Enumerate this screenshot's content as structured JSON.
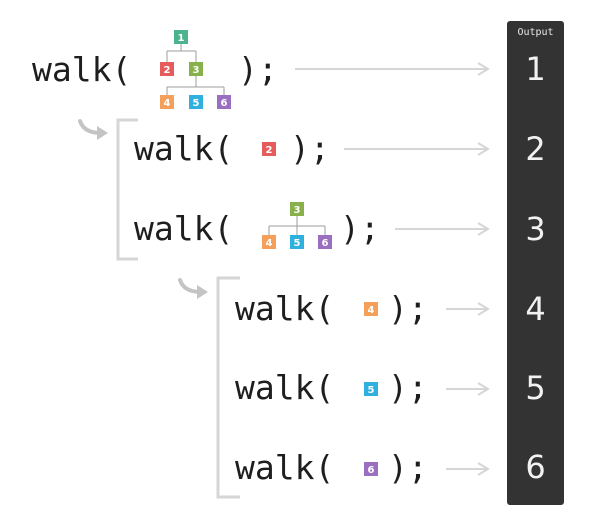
{
  "colors": {
    "node1": "#4db38e",
    "node2": "#e65c5c",
    "node3": "#88b04b",
    "node4": "#f5a05a",
    "node5": "#2fb0de",
    "node6": "#9b6fc0",
    "output_bg": "#333333"
  },
  "output": {
    "title": "Output",
    "values": [
      "1",
      "2",
      "3",
      "4",
      "5",
      "6"
    ]
  },
  "calls": [
    {
      "prefix": "walk(",
      "suffix": ");"
    },
    {
      "prefix": "walk(",
      "suffix": ");"
    },
    {
      "prefix": "walk(",
      "suffix": ");"
    },
    {
      "prefix": "walk(",
      "suffix": ");"
    },
    {
      "prefix": "walk(",
      "suffix": ");"
    },
    {
      "prefix": "walk(",
      "suffix": ");"
    }
  ],
  "nodes": {
    "n1": "1",
    "n2": "2",
    "n3": "3",
    "n4": "4",
    "n5": "5",
    "n6": "6"
  }
}
